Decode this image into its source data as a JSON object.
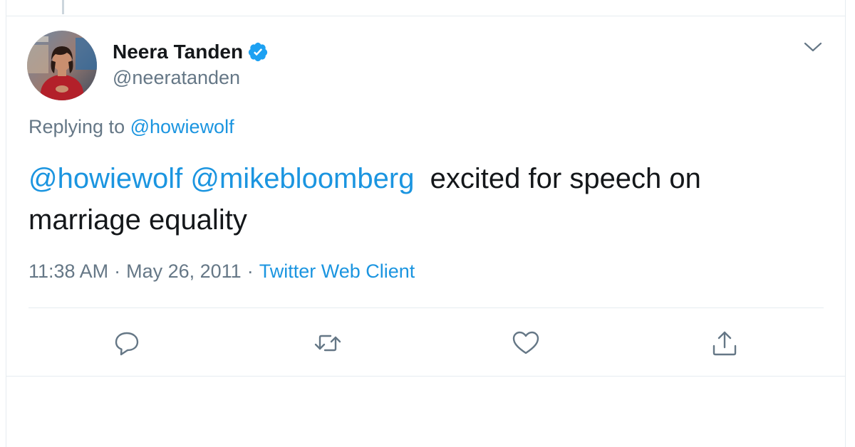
{
  "author": {
    "display_name": "Neera Tanden",
    "handle": "@neeratanden",
    "verified": true
  },
  "reply": {
    "prefix": "Replying to",
    "to": "@howiewolf"
  },
  "tweet": {
    "mention_1": "@howiewolf",
    "mention_2": "@mikebloomberg",
    "text": "excited for speech on marriage equality"
  },
  "meta": {
    "time": "11:38 AM",
    "date": "May 26, 2011",
    "separator": "·",
    "source": "Twitter Web Client"
  },
  "actions": [
    {
      "icon": "reply-icon"
    },
    {
      "icon": "retweet-icon"
    },
    {
      "icon": "like-icon"
    },
    {
      "icon": "share-icon"
    }
  ],
  "colors": {
    "link": "#1b95e0",
    "text": "#14171a",
    "secondary": "#657786",
    "border": "#e6ecf0",
    "verified": "#1da1f2"
  }
}
